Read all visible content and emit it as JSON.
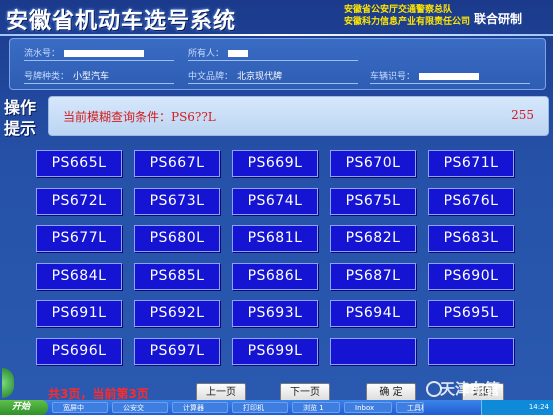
{
  "header": {
    "title": "安徽省机动车选号系统",
    "org_line1": "安徽省公安厅交通警察总队",
    "org_line2": "安徽科力信息产业有限责任公司",
    "joint_label": "联合研制"
  },
  "info": {
    "serial_label": "流水号：",
    "owner_label": "所有人：",
    "plate_type_label": "号牌种类：",
    "plate_type_value": "小型汽车",
    "brand_label": "中文品牌：",
    "brand_value": "北京现代牌",
    "vin_label": "车辆识号："
  },
  "hint": {
    "label_line1": "操作",
    "label_line2": "提示",
    "query_text": "当前模糊查询条件：PS6??L",
    "count": "255"
  },
  "plates": [
    "PS665L",
    "PS667L",
    "PS669L",
    "PS670L",
    "PS671L",
    "PS672L",
    "PS673L",
    "PS674L",
    "PS675L",
    "PS676L",
    "PS677L",
    "PS680L",
    "PS681L",
    "PS682L",
    "PS683L",
    "PS684L",
    "PS685L",
    "PS686L",
    "PS687L",
    "PS690L",
    "PS691L",
    "PS692L",
    "PS693L",
    "PS694L",
    "PS695L",
    "PS696L",
    "PS697L",
    "PS699L",
    "",
    ""
  ],
  "footer": {
    "page_info": "共3页，当前第3页",
    "prev_label": "上一页",
    "next_label": "下一页",
    "confirm_label": "确 定",
    "back_label": "返回"
  },
  "watermark": "天津车管",
  "taskbar": {
    "start_label": "开始",
    "tasks": [
      "宽屏中",
      "公安交",
      "计算器",
      "打印机",
      "浏览 1",
      "Inbox",
      "工具栏"
    ],
    "clock": "14:24"
  },
  "colors": {
    "plate_blue": "#1414d2",
    "hint_red": "#d21c1c",
    "org_yellow": "#ffe600"
  }
}
